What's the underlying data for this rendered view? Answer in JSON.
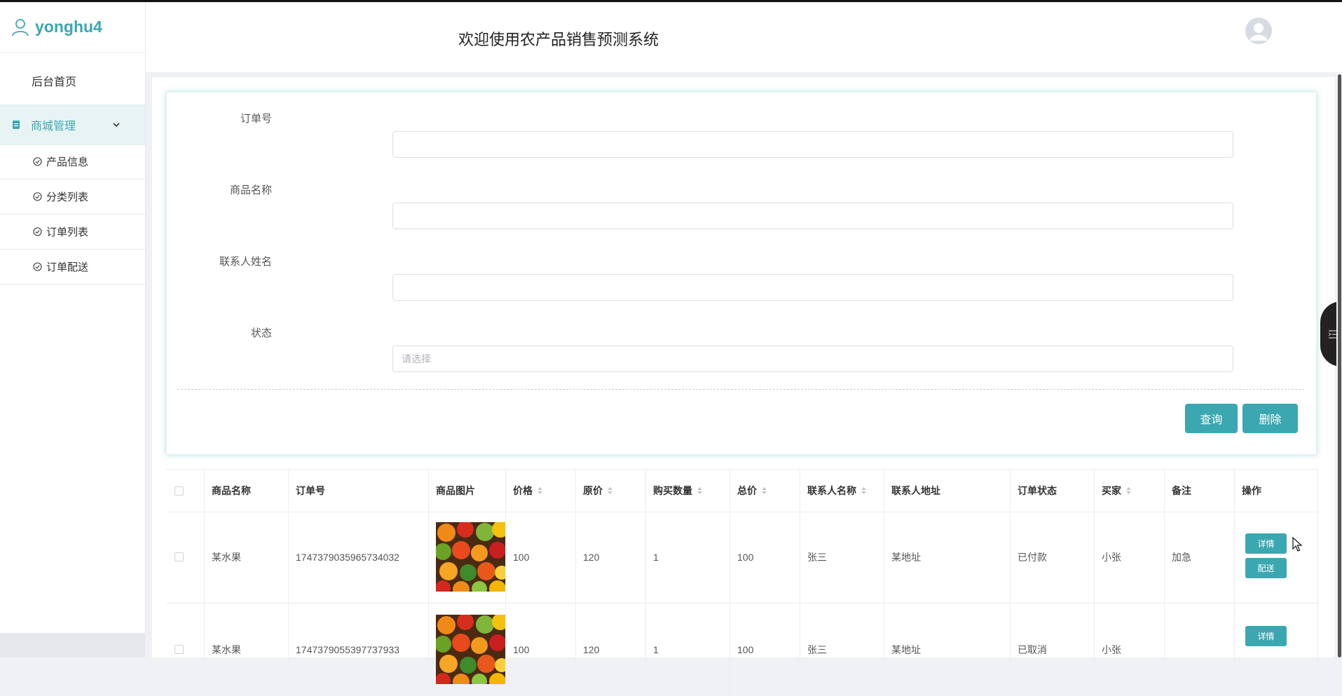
{
  "sidebar": {
    "user": "yonghu4",
    "home": "后台首页",
    "group": "商城管理",
    "items": [
      "产品信息",
      "分类列表",
      "订单列表",
      "订单配送"
    ]
  },
  "header": {
    "title": "欢迎使用农产品销售预测系统"
  },
  "form": {
    "fields": [
      {
        "label": "订单号",
        "value": ""
      },
      {
        "label": "商品名称",
        "value": ""
      },
      {
        "label": "联系人姓名",
        "value": ""
      }
    ],
    "status_label": "状态",
    "status_placeholder": "请选择",
    "query_button": "查询",
    "delete_button": "删除"
  },
  "table": {
    "columns": [
      "商品名称",
      "订单号",
      "商品图片",
      "价格",
      "原价",
      "购买数量",
      "总价",
      "联系人名称",
      "联系人地址",
      "订单状态",
      "买家",
      "备注",
      "操作"
    ],
    "rows": [
      {
        "name": "某水果",
        "order_no": "1747379035965734032",
        "price": "100",
        "orig_price": "120",
        "qty": "1",
        "total": "100",
        "contact": "张三",
        "address": "某地址",
        "status": "已付款",
        "buyer": "小张",
        "remark": "加急",
        "actions": [
          "详情",
          "配送"
        ]
      },
      {
        "name": "某水果",
        "order_no": "1747379055397737933",
        "price": "100",
        "orig_price": "120",
        "qty": "1",
        "total": "100",
        "contact": "张三",
        "address": "某地址",
        "status": "已取消",
        "buyer": "小张",
        "remark": "",
        "actions": [
          "详情"
        ]
      }
    ]
  },
  "colors": {
    "accent": "#3ba7b0",
    "accent_bg": "#e8f4f3"
  }
}
